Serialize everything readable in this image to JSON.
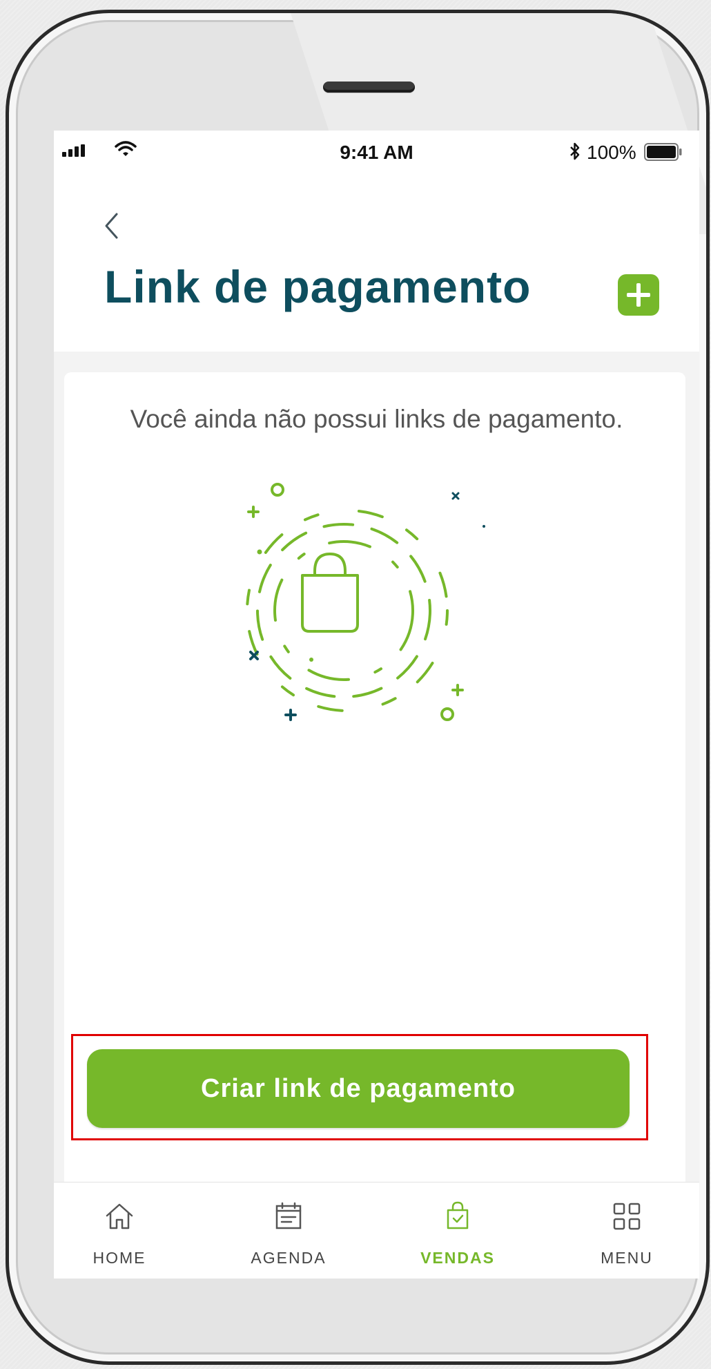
{
  "status_bar": {
    "time": "9:41 AM",
    "battery": "100%",
    "icons": [
      "signal-icon",
      "wifi-icon",
      "bluetooth-icon",
      "battery-icon"
    ]
  },
  "header": {
    "back_icon": "chevron-left-icon",
    "title": "Link de pagamento",
    "add_icon": "plus-icon"
  },
  "empty_state": {
    "message": "Você ainda não possui links de pagamento.",
    "illustration_icon": "shopping-bag-icon"
  },
  "cta": {
    "label": "Criar link de pagamento"
  },
  "tab_bar": {
    "items": [
      {
        "label": "HOME",
        "icon": "home-icon",
        "active": false
      },
      {
        "label": "AGENDA",
        "icon": "calendar-icon",
        "active": false
      },
      {
        "label": "VENDAS",
        "icon": "shopping-bag-check-icon",
        "active": true
      },
      {
        "label": "MENU",
        "icon": "grid-icon",
        "active": false
      }
    ]
  },
  "colors": {
    "brand_green": "#76b82a",
    "title_teal": "#0e4e5e",
    "highlight_red": "#e00000"
  }
}
